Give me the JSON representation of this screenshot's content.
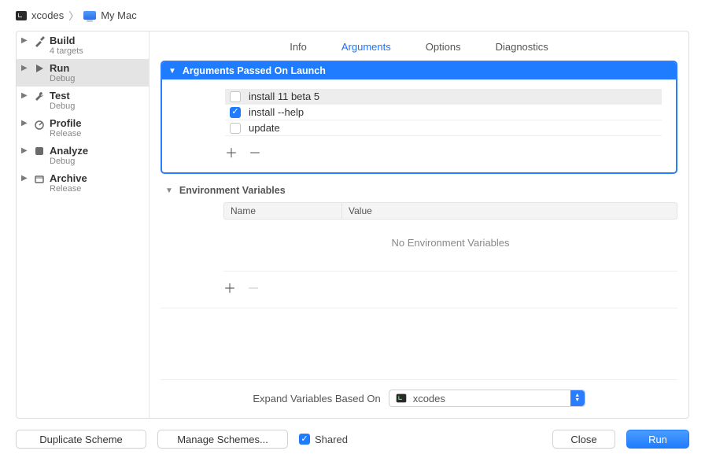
{
  "breadcrumb": {
    "scheme": "xcodes",
    "destination": "My Mac"
  },
  "sidebar": {
    "items": [
      {
        "title": "Build",
        "sub": "4 targets"
      },
      {
        "title": "Run",
        "sub": "Debug"
      },
      {
        "title": "Test",
        "sub": "Debug"
      },
      {
        "title": "Profile",
        "sub": "Release"
      },
      {
        "title": "Analyze",
        "sub": "Debug"
      },
      {
        "title": "Archive",
        "sub": "Release"
      }
    ]
  },
  "tabs": {
    "info": "Info",
    "arguments": "Arguments",
    "options": "Options",
    "diagnostics": "Diagnostics"
  },
  "argsSection": {
    "header": "Arguments Passed On Launch",
    "rows": [
      {
        "checked": false,
        "text": "install 11 beta 5"
      },
      {
        "checked": true,
        "text": "install --help"
      },
      {
        "checked": false,
        "text": "update"
      }
    ]
  },
  "envSection": {
    "header": "Environment Variables",
    "nameCol": "Name",
    "valueCol": "Value",
    "empty": "No Environment Variables"
  },
  "expandLabel": "Expand Variables Based On",
  "expandValue": "xcodes",
  "buttons": {
    "duplicate": "Duplicate Scheme",
    "manage": "Manage Schemes...",
    "shared": "Shared",
    "close": "Close",
    "run": "Run"
  }
}
